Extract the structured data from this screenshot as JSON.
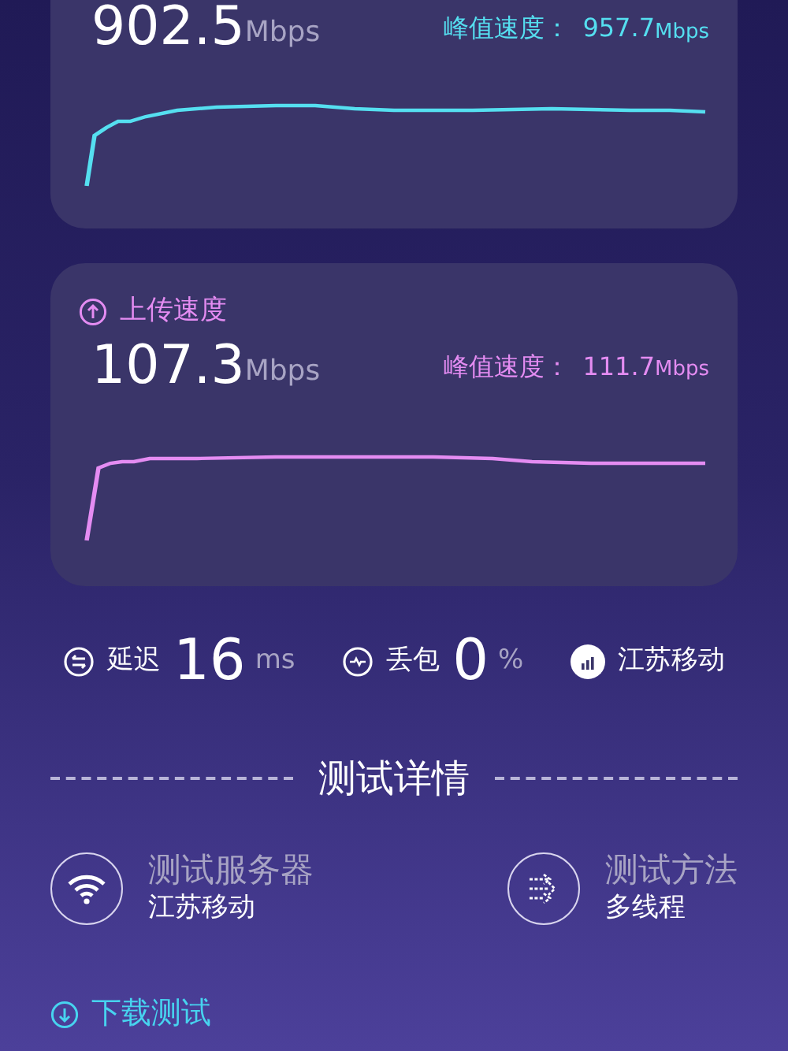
{
  "speed_cards": [
    {
      "kind": "download",
      "speed": "902.5",
      "unit": "Mbps",
      "peak_label": "峰值速度：",
      "peak": "957.7",
      "peak_unit": "Mbps"
    },
    {
      "kind": "upload",
      "title": "上传速度",
      "speed": "107.3",
      "unit": "Mbps",
      "peak_label": "峰值速度：",
      "peak": "111.7",
      "peak_unit": "Mbps"
    }
  ],
  "stats": [
    {
      "kind": "latency",
      "label": "延迟",
      "value": "16",
      "unit": "ms"
    },
    {
      "kind": "loss",
      "label": "丢包",
      "value": "0",
      "unit": "%"
    },
    {
      "kind": "carrier",
      "label": "江苏移动"
    }
  ],
  "details_title": "测试详情",
  "details": [
    {
      "kind": "server",
      "label": "测试服务器",
      "value": "江苏移动"
    },
    {
      "kind": "method",
      "label": "测试方法",
      "value": "多线程"
    }
  ],
  "section": {
    "title": "下载测试"
  }
}
